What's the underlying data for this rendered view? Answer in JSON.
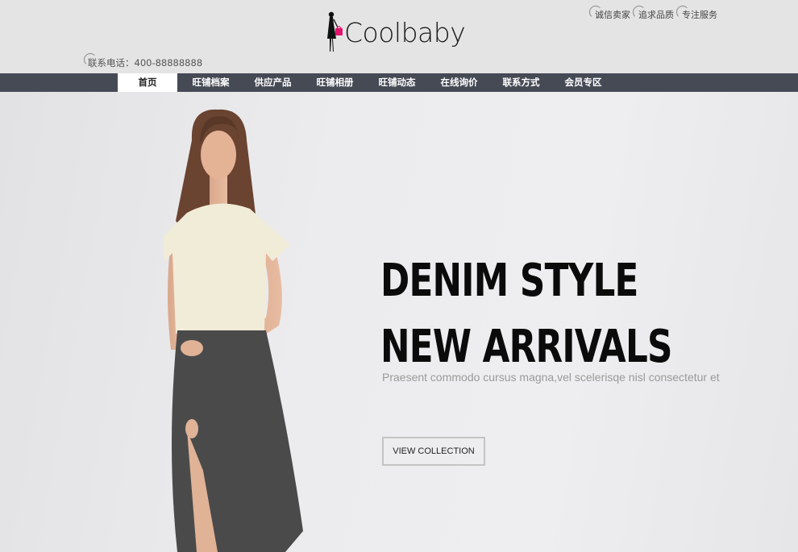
{
  "brand": {
    "name": "Coolbaby",
    "accent": "#e0156b"
  },
  "top_links": [
    "诚信卖家",
    "追求品质",
    "专注服务"
  ],
  "phone": {
    "label": "联系电话：",
    "number": "400-88888888"
  },
  "nav": {
    "items": [
      "首页",
      "旺铺档案",
      "供应产品",
      "旺铺相册",
      "旺铺动态",
      "在线询价",
      "联系方式",
      "会员专区"
    ],
    "active_index": 0,
    "bg": "#454a55"
  },
  "hero": {
    "headline_line1": "DENIM STYLE",
    "headline_line2": "NEW ARRIVALS",
    "subtext": "Praesent commodo cursus magna,vel scelerisqe nisl consectetur et",
    "cta": "VIEW COLLECTION"
  }
}
